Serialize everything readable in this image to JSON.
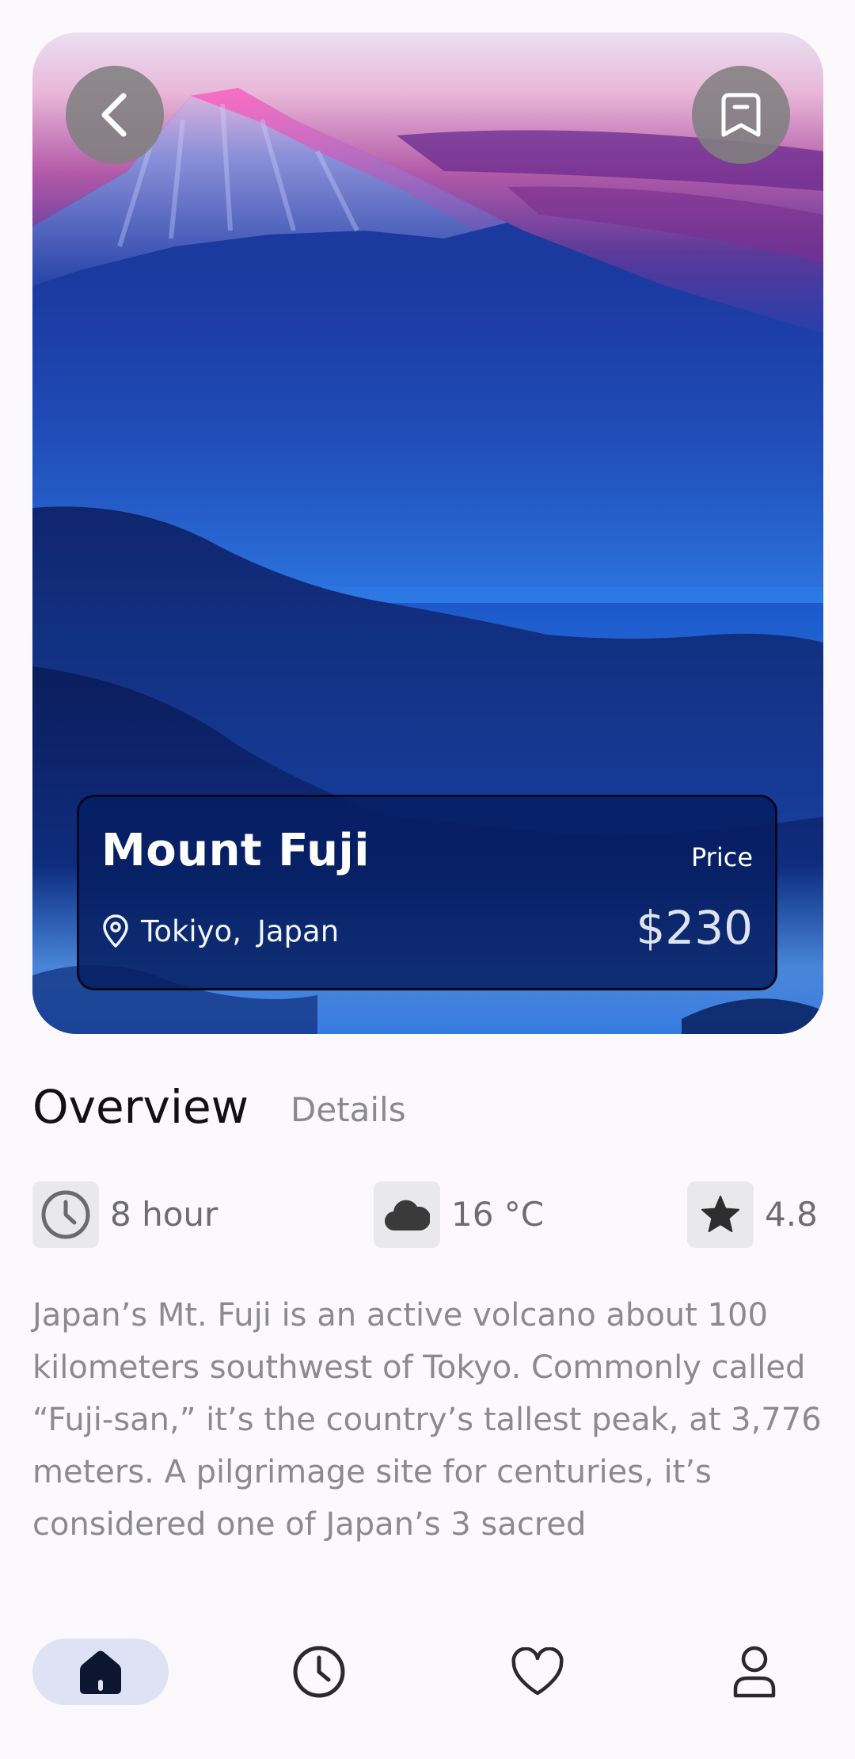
{
  "place": {
    "title": "Mount Fuji",
    "city": "Tokiyo,",
    "country": "Japan",
    "price_label": "Price",
    "price_value": "$230"
  },
  "tabs": {
    "overview": "Overview",
    "details": "Details"
  },
  "stats": {
    "duration": "8 hour",
    "temperature": "16 °C",
    "rating": "4.8"
  },
  "description": "Japan’s Mt. Fuji is an active volcano about 100 kilometers southwest of Tokyo. Commonly called “Fuji-san,” it’s the country’s tallest peak, at 3,776 meters. A pilgrimage site for centuries, it’s considered one of Japan’s 3 sacred",
  "icons": {
    "back": "chevron-left-icon",
    "bookmark": "bookmark-icon",
    "location": "map-pin-icon",
    "duration": "clock-icon",
    "weather": "cloud-icon",
    "rating": "star-icon",
    "nav_home": "home-icon",
    "nav_history": "clock-icon",
    "nav_favorites": "heart-icon",
    "nav_profile": "user-icon"
  },
  "colors": {
    "background": "#fbf9fc",
    "card_overlay": "#061e62",
    "nav_active_pill": "#dde3f5",
    "text_primary": "#111111",
    "text_muted": "#8b8b8b"
  }
}
